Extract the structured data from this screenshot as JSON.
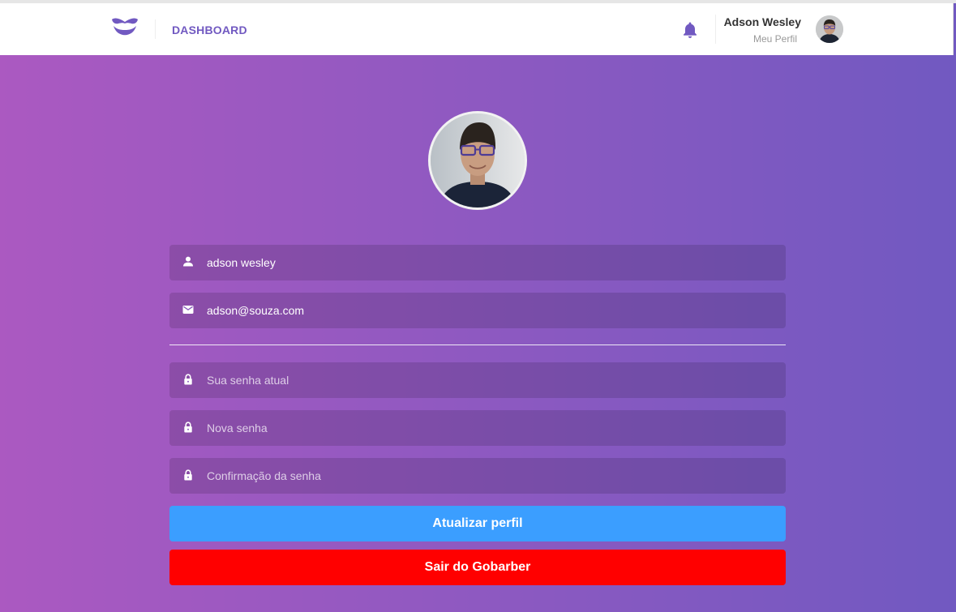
{
  "header": {
    "nav_label": "DASHBOARD",
    "user_name": "Adson Wesley",
    "profile_link": "Meu Perfil"
  },
  "colors": {
    "brand": "#7159c1",
    "gradient_start": "#ab59c1",
    "update_button": "#3b9eff",
    "logout_button": "#ff0000"
  },
  "icons": {
    "logo": "gobarber-mustache-logo",
    "notifications": "bell-icon",
    "name": "person-icon",
    "email": "mail-icon",
    "password": "lock-icon"
  },
  "form": {
    "name_value": "adson wesley",
    "email_value": "adson@souza.com",
    "old_password_placeholder": "Sua senha atual",
    "new_password_placeholder": "Nova senha",
    "confirm_password_placeholder": "Confirmação da senha",
    "submit_label": "Atualizar perfil"
  },
  "logout_label": "Sair do Gobarber"
}
